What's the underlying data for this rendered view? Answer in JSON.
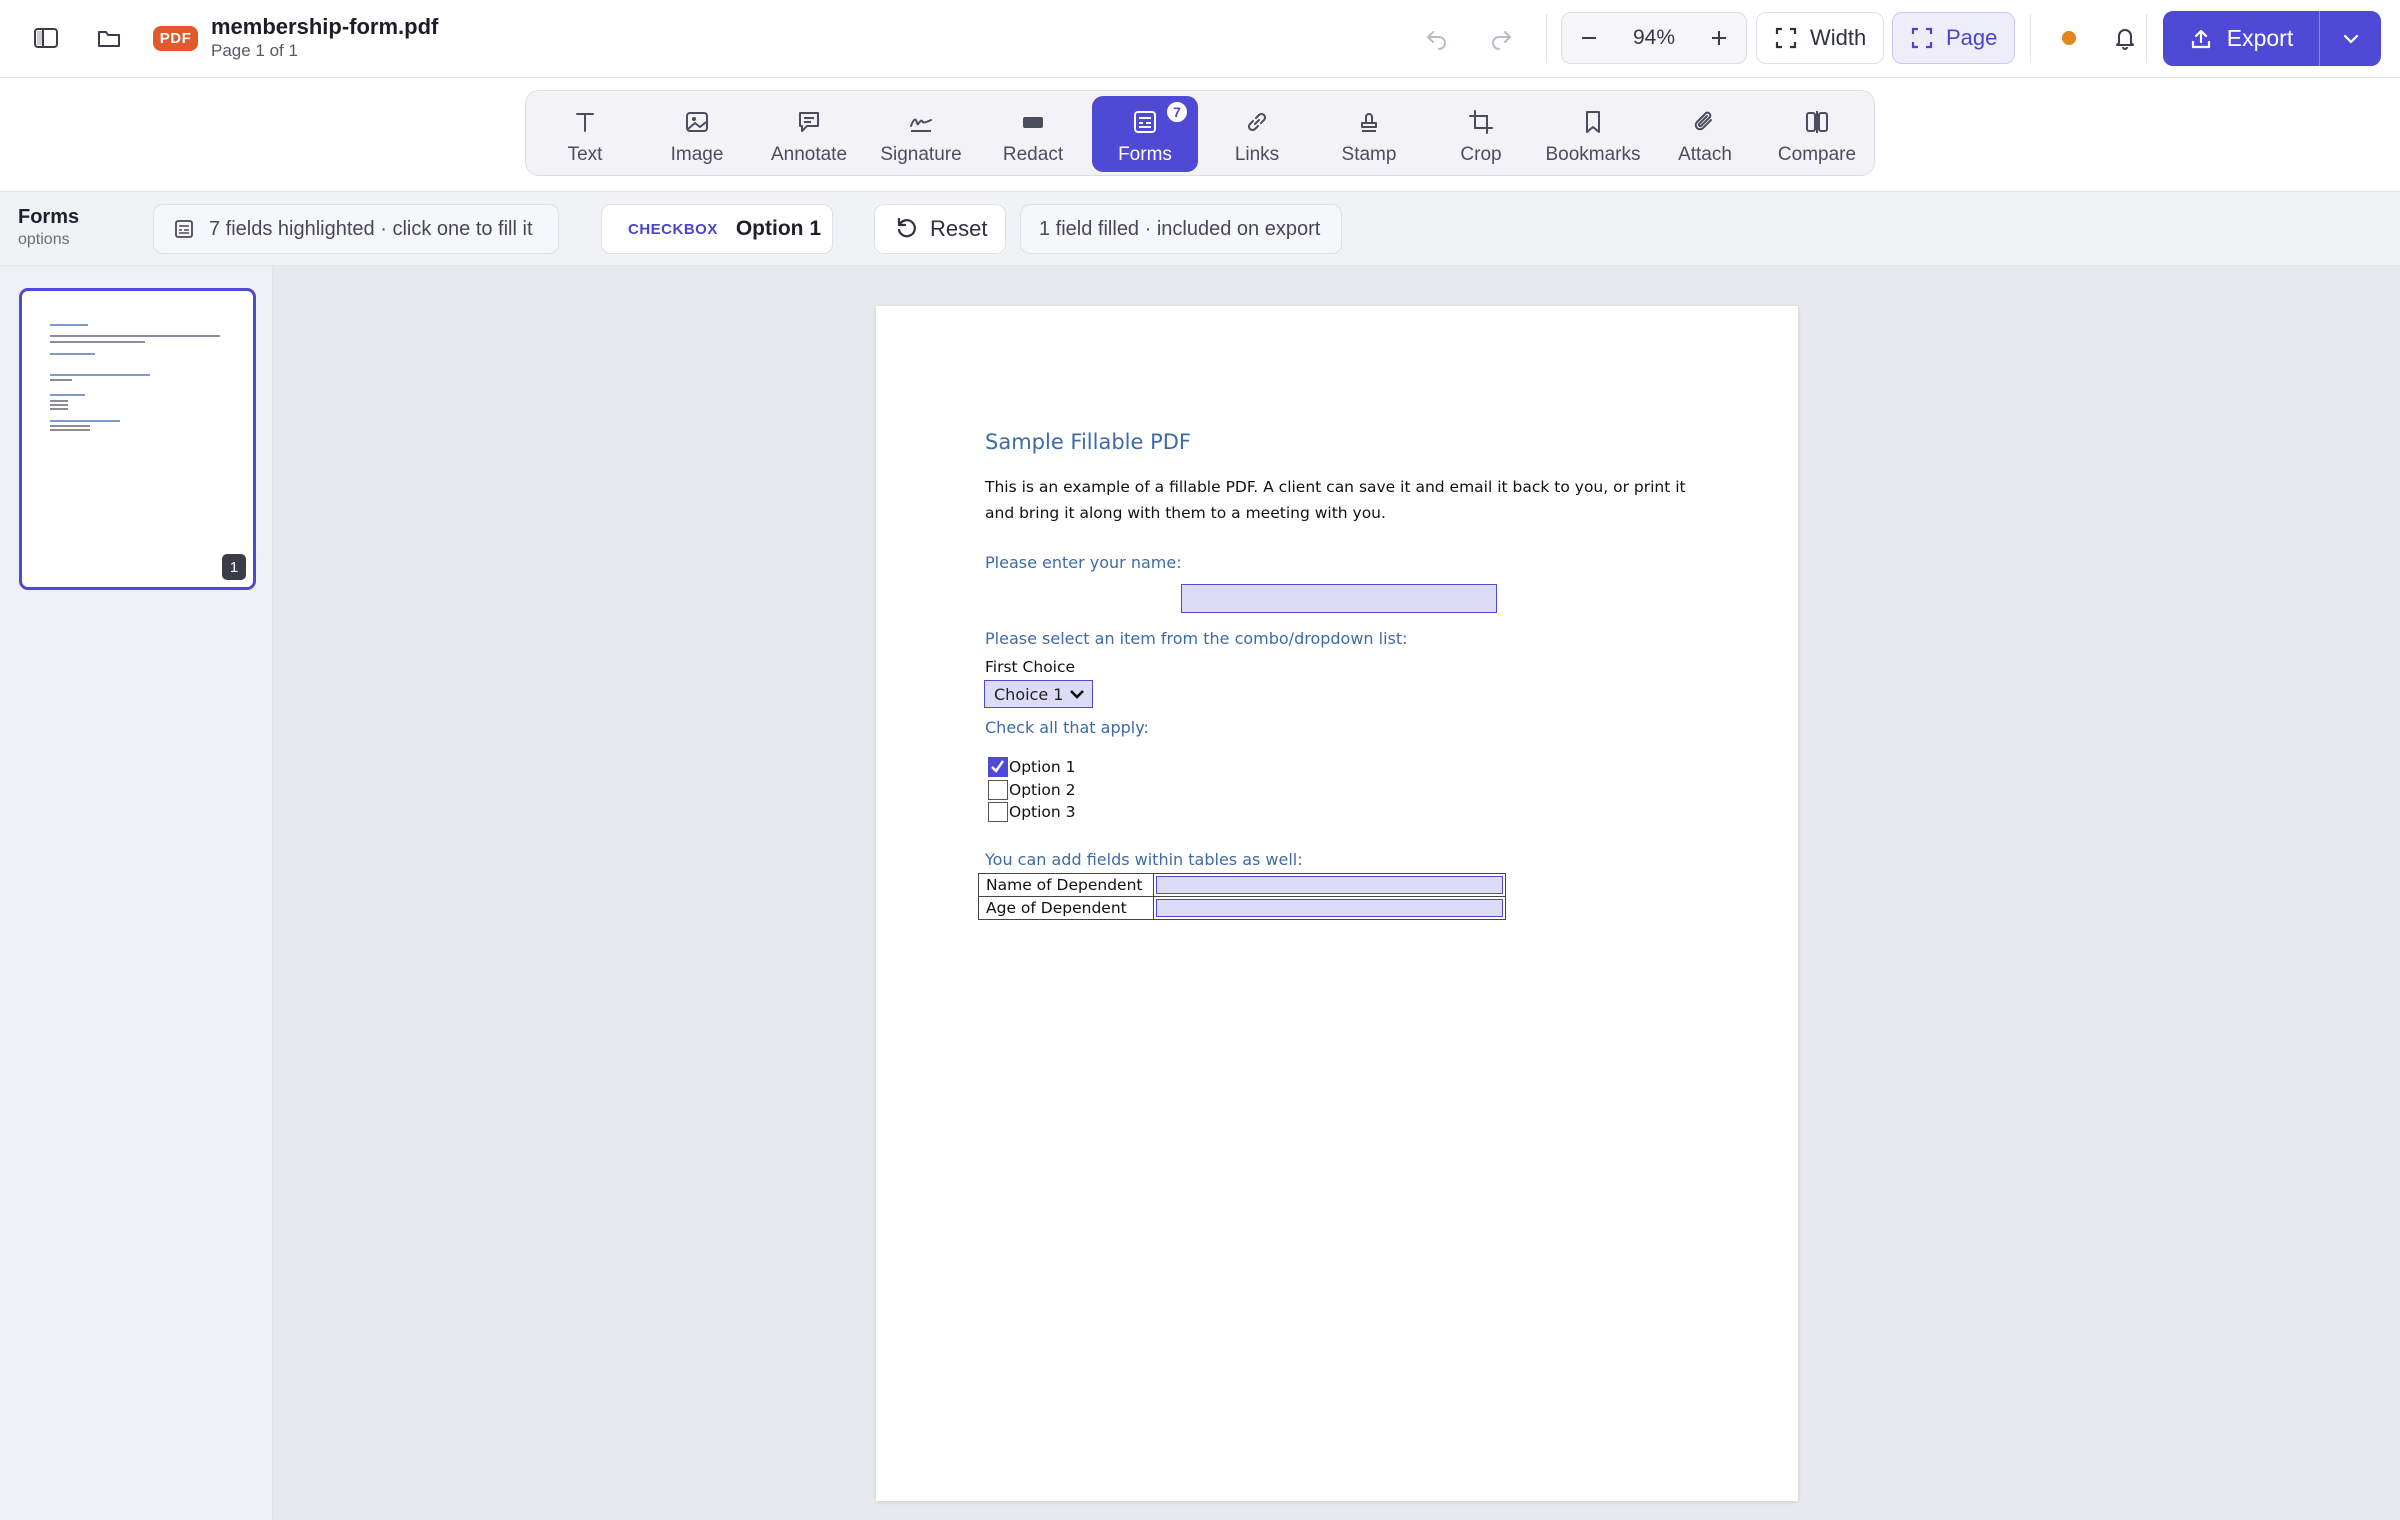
{
  "header": {
    "file_badge": "PDF",
    "file_name": "membership-form.pdf",
    "page_info": "Page 1 of 1",
    "zoom_value": "94%",
    "fit_width_label": "Width",
    "fit_page_label": "Page",
    "export_label": "Export",
    "status_dot_color": "#e0861a"
  },
  "tools": [
    {
      "label": "Text",
      "icon": "text-icon"
    },
    {
      "label": "Image",
      "icon": "image-icon"
    },
    {
      "label": "Annotate",
      "icon": "annotate-icon"
    },
    {
      "label": "Signature",
      "icon": "signature-icon"
    },
    {
      "label": "Redact",
      "icon": "redact-icon"
    },
    {
      "label": "Forms",
      "icon": "forms-icon",
      "badge": "7",
      "active": true
    },
    {
      "label": "Links",
      "icon": "link-icon"
    },
    {
      "label": "Stamp",
      "icon": "stamp-icon"
    },
    {
      "label": "Crop",
      "icon": "crop-icon"
    },
    {
      "label": "Bookmarks",
      "icon": "bookmark-icon"
    },
    {
      "label": "Attach",
      "icon": "paperclip-icon"
    },
    {
      "label": "Compare",
      "icon": "compare-icon"
    }
  ],
  "options": {
    "title": "Forms",
    "subtitle": "options",
    "fields_info": "7 fields highlighted · click one to fill it",
    "selected_type": "CHECKBOX",
    "selected_value": "Option 1",
    "reset_label": "Reset",
    "filled_info": "1 field filled · included on export"
  },
  "thumbnail": {
    "page_number": "1"
  },
  "document": {
    "title": "Sample Fillable PDF",
    "intro": "This is an example of a fillable PDF. A client can save it and email it back to you, or print it and bring it along with them to a meeting with you.",
    "name_prompt": "Please enter your name:",
    "combo_prompt": "Please select an item from the combo/dropdown list:",
    "combo_caption": "First Choice",
    "combo_value": "Choice 1",
    "check_prompt": "Check all that apply:",
    "checkboxes": [
      {
        "label": "Option 1",
        "checked": true
      },
      {
        "label": "Option 2",
        "checked": false
      },
      {
        "label": "Option 3",
        "checked": false
      }
    ],
    "table_prompt": "You can add  fields within tables as well:",
    "table_rows": [
      {
        "label": "Name of Dependent"
      },
      {
        "label": "Age of Dependent"
      }
    ]
  },
  "colors": {
    "accent": "#4f4ad6",
    "pdf_badge": "#e05a2b",
    "heading_blue": "#3e6aa6",
    "field_fill": "#dcdcf6"
  }
}
